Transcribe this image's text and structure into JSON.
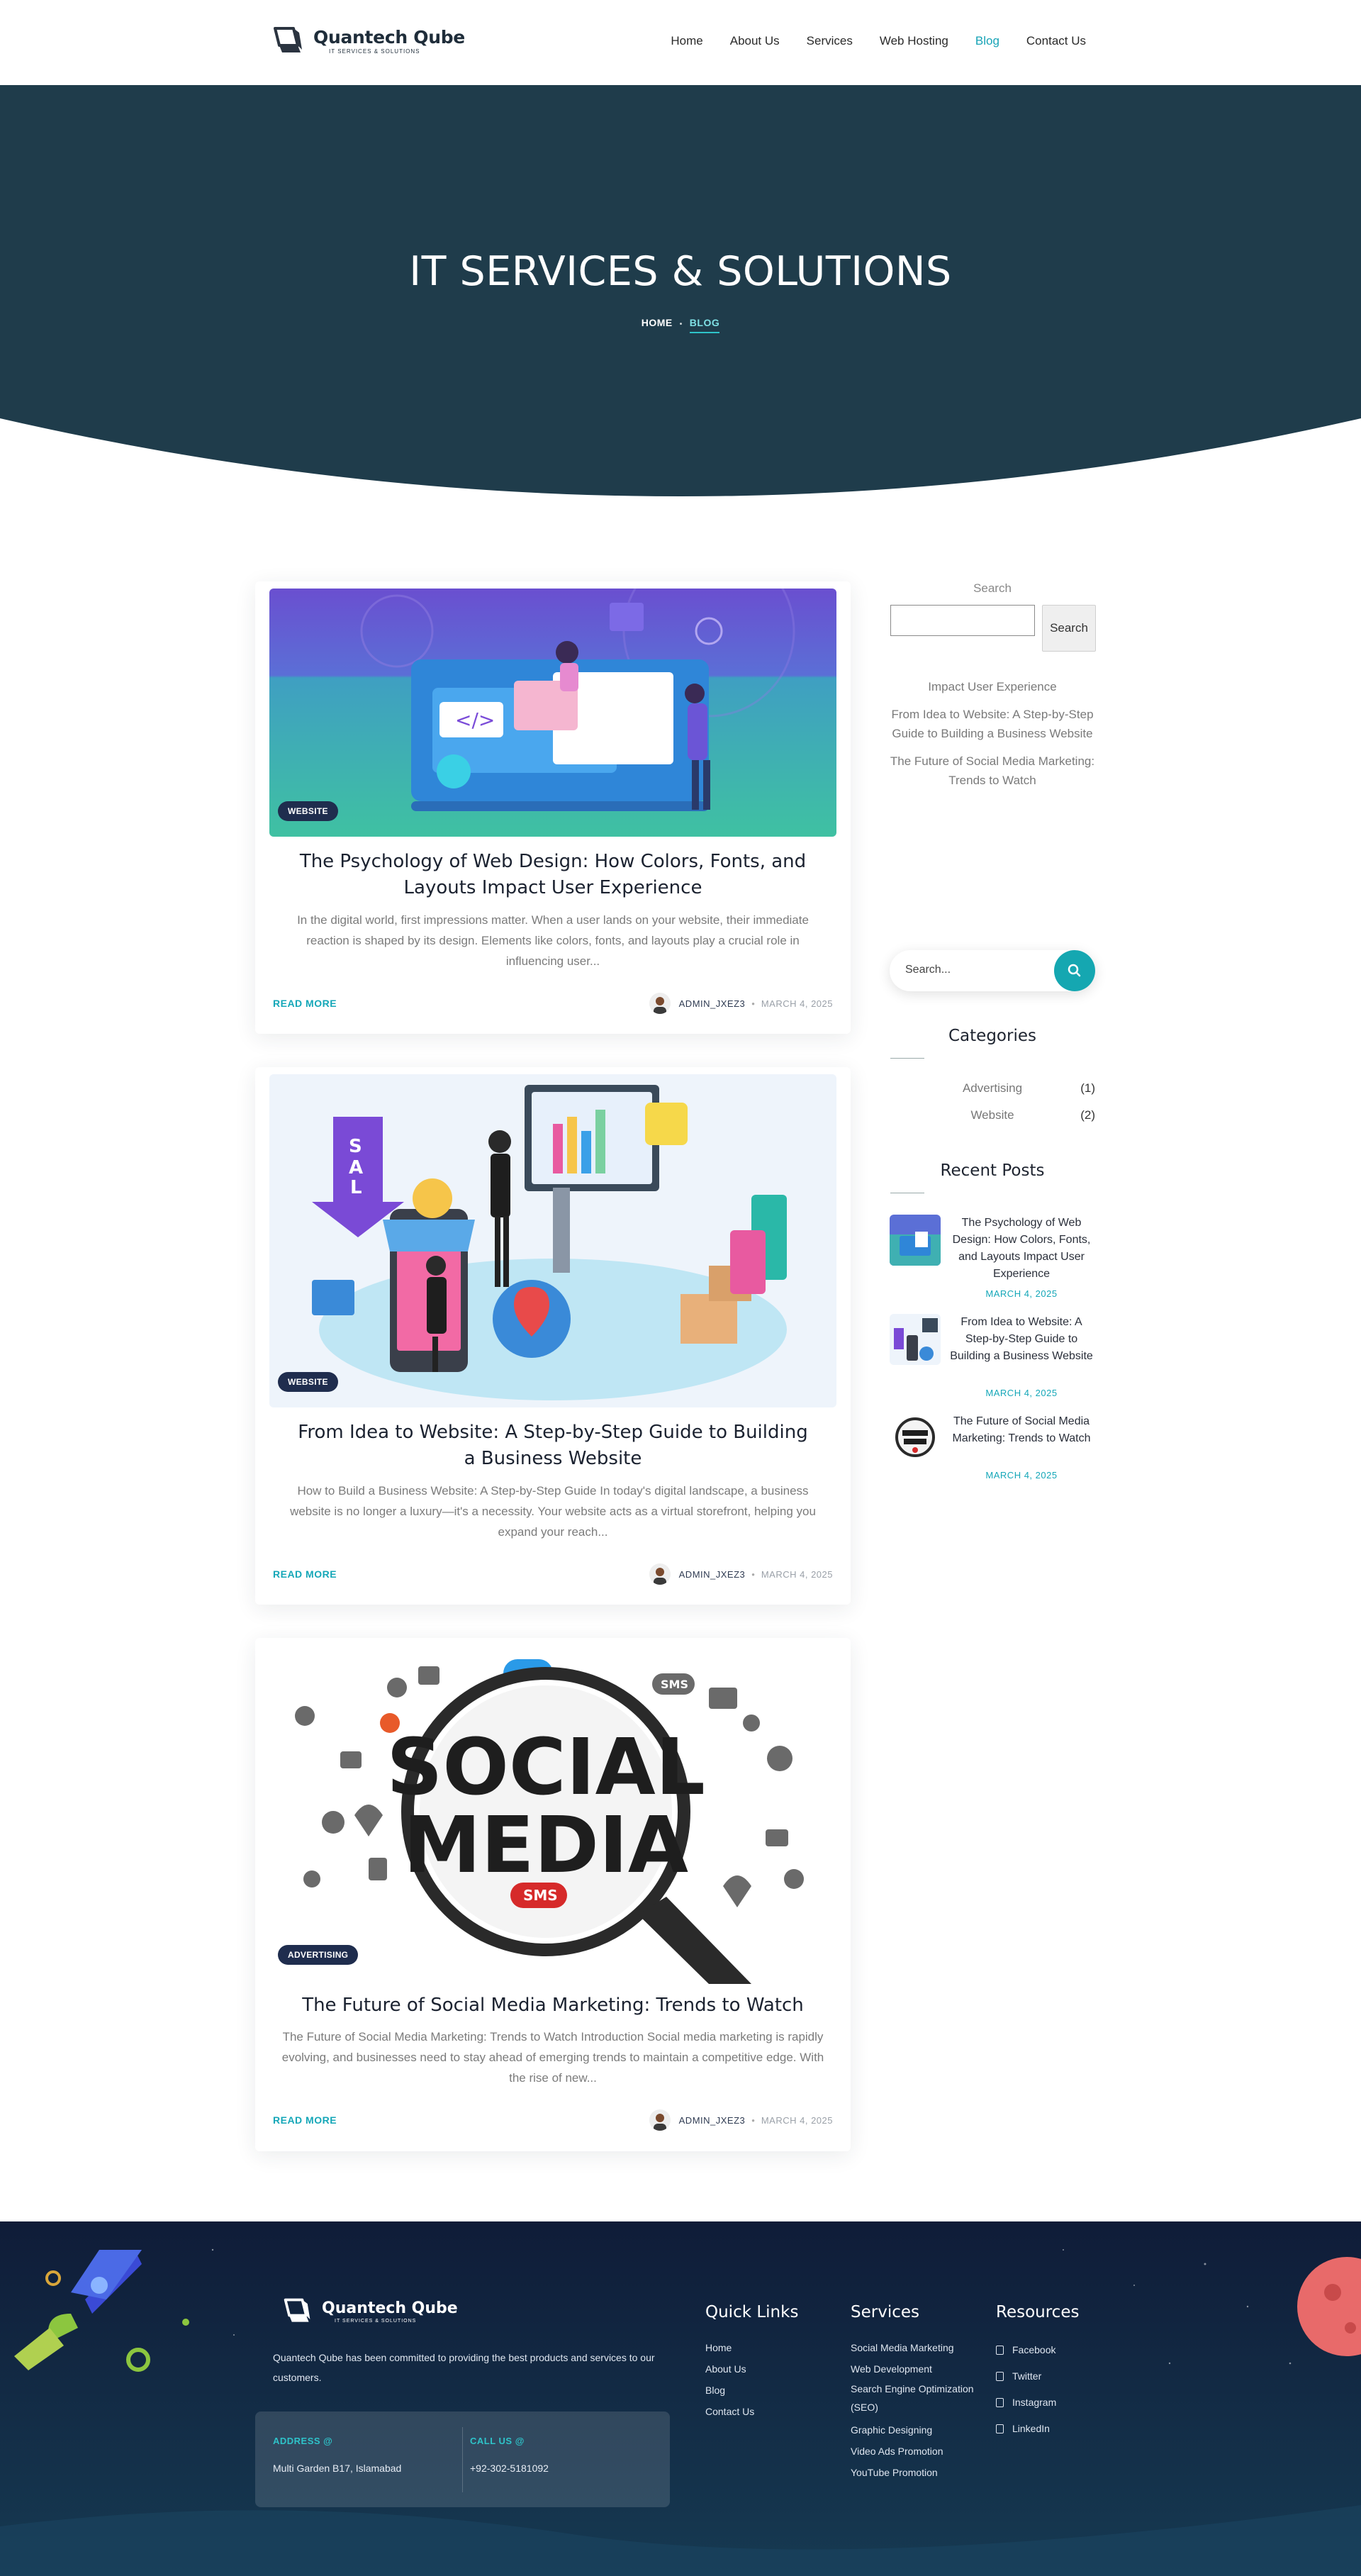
{
  "brand": {
    "name": "Quantech Qube",
    "tagline": "IT SERVICES & SOLUTIONS"
  },
  "nav": {
    "items": [
      "Home",
      "About Us",
      "Services",
      "Web Hosting",
      "Blog",
      "Contact Us"
    ],
    "active": "Blog"
  },
  "hero": {
    "title": "IT SERVICES & SOLUTIONS",
    "crumb_home": "HOME",
    "crumb_current": "BLOG"
  },
  "posts": [
    {
      "category": "WEBSITE",
      "title": "The Psychology of Web Design: How Colors, Fonts, and Layouts Impact User Experience",
      "excerpt": "In the digital world, first impressions matter. When a user lands on your website, their immediate reaction is shaped by its design. Elements like colors, fonts, and layouts play a crucial role in influencing user...",
      "read_more": "READ MORE",
      "author": "ADMIN_JXEZ3",
      "date": "MARCH 4, 2025"
    },
    {
      "category": "WEBSITE",
      "title": "From Idea to Website: A Step-by-Step Guide to Building a Business Website",
      "excerpt": "How to Build a Business Website: A Step-by-Step Guide In today's digital landscape, a business website is no longer a luxury—it's a necessity. Your website acts as a virtual storefront, helping you expand your reach...",
      "read_more": "READ MORE",
      "author": "ADMIN_JXEZ3",
      "date": "MARCH 4, 2025"
    },
    {
      "category": "ADVERTISING",
      "title": "The Future of Social Media Marketing: Trends to Watch",
      "excerpt": "The Future of Social Media Marketing: Trends to Watch Introduction Social media marketing is rapidly evolving, and businesses need to stay ahead of emerging trends to maintain a competitive edge. With the rise of new...",
      "read_more": "READ MORE",
      "author": "ADMIN_JXEZ3",
      "date": "MARCH 4, 2025"
    }
  ],
  "sidebar": {
    "search_label": "Search",
    "search_button": "Search",
    "link_list": [
      "Impact User Experience",
      "From Idea to Website: A Step-by-Step Guide to Building a Business Website",
      "The Future of Social Media Marketing: Trends to Watch"
    ],
    "search2_placeholder": "Search...",
    "categories_title": "Categories",
    "categories": [
      {
        "name": "Advertising",
        "count": "(1)"
      },
      {
        "name": "Website",
        "count": "(2)"
      }
    ],
    "recent_title": "Recent Posts",
    "recent": [
      {
        "title": "The Psychology of Web Design: How Colors, Fonts, and Layouts Impact User Experience",
        "date": "MARCH 4, 2025"
      },
      {
        "title": "From Idea to Website: A Step-by-Step Guide to Building a Business Website",
        "date": "MARCH 4, 2025"
      },
      {
        "title": "The Future of Social Media Marketing: Trends to Watch",
        "date": "MARCH 4, 2025"
      }
    ]
  },
  "footer": {
    "about": "Quantech Qube has been committed to providing the best products and services to our customers.",
    "address_label": "ADDRESS @",
    "address": "Multi Garden B17, Islamabad",
    "call_label": "CALL US @",
    "phone": "+92-302-5181092",
    "quick_title": "Quick Links",
    "quick": [
      "Home",
      "About Us",
      "Blog",
      "Contact Us"
    ],
    "services_title": "Services",
    "services": [
      "Social Media Marketing",
      "Web Development",
      "Search Engine Optimization (SEO)",
      "Graphic Designing",
      "Video Ads Promotion",
      "YouTube Promotion"
    ],
    "resources_title": "Resources",
    "resources": [
      "Facebook",
      "Twitter",
      "Instagram",
      "LinkedIn"
    ]
  },
  "colors": {
    "accent": "#15a7b8",
    "hero_bg": "#1f3c4b",
    "footer_bg": "#0f1c38",
    "badge": "#1f2d4e"
  }
}
